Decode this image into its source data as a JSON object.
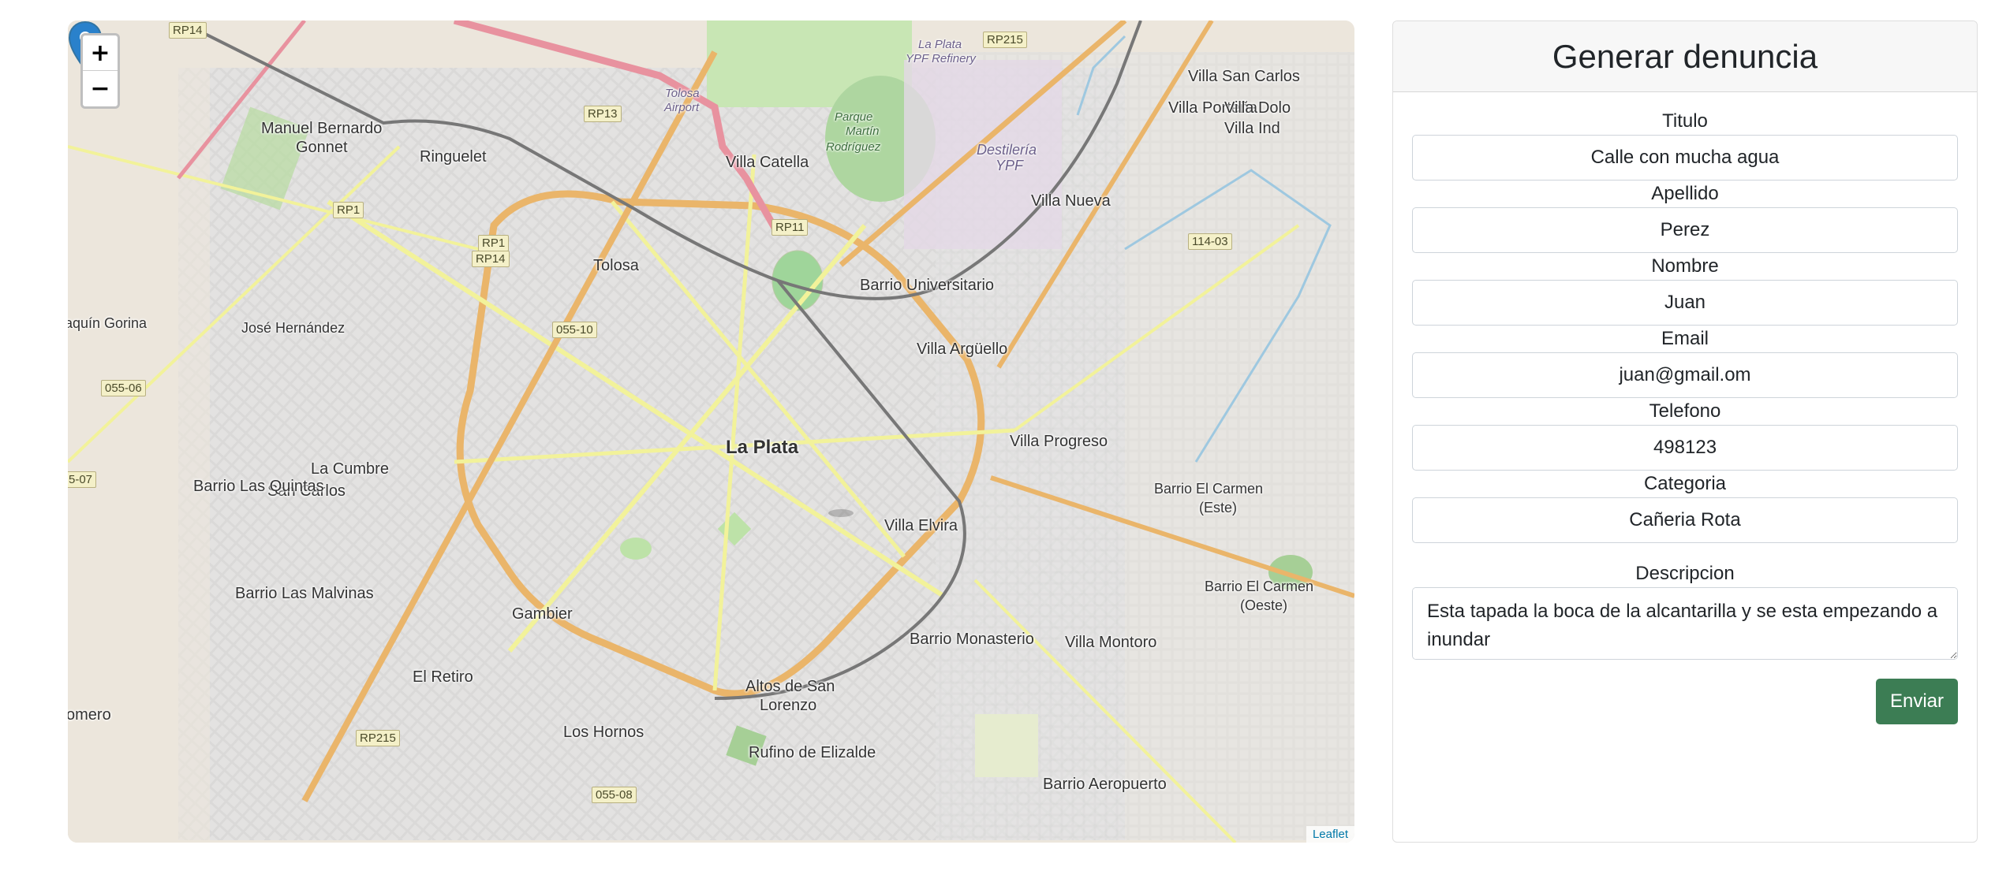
{
  "map": {
    "zoom_in": "+",
    "zoom_out": "−",
    "attribution": "Leaflet",
    "places": [
      {
        "name": "Manuel Bernardo",
        "size": "l"
      },
      {
        "name": "Gonnet",
        "size": "l"
      },
      {
        "name": "Ringuelet",
        "size": "l"
      },
      {
        "name": "Tolosa",
        "size": "l"
      },
      {
        "name": "José Hernández",
        "size": "m"
      },
      {
        "name": "aquín Gorina",
        "size": "m"
      },
      {
        "name": "La Plata",
        "size": "xl"
      },
      {
        "name": "La Cumbre",
        "size": "l"
      },
      {
        "name": "San Carlos",
        "size": "l"
      },
      {
        "name": "Barrio Las Quintas",
        "size": "l"
      },
      {
        "name": "Barrio Las Malvinas",
        "size": "l"
      },
      {
        "name": "Gambier",
        "size": "l"
      },
      {
        "name": "El Retiro",
        "size": "l"
      },
      {
        "name": "omero",
        "size": "l"
      },
      {
        "name": "Los Hornos",
        "size": "l"
      },
      {
        "name": "Altos de San",
        "size": "l"
      },
      {
        "name": "Lorenzo",
        "size": "l"
      },
      {
        "name": "Rufino de Elizalde",
        "size": "l"
      },
      {
        "name": "Villa Elvira",
        "size": "l"
      },
      {
        "name": "Barrio Monasterio",
        "size": "l"
      },
      {
        "name": "Villa Montoro",
        "size": "l"
      },
      {
        "name": "Barrio Aeropuerto",
        "size": "l"
      },
      {
        "name": "Villa Progreso",
        "size": "l"
      },
      {
        "name": "Barrio El Carmen",
        "size": "m"
      },
      {
        "name": "(Este)",
        "size": "m"
      },
      {
        "name": "Barrio El Carmen",
        "size": "m"
      },
      {
        "name": "(Oeste)",
        "size": "m"
      },
      {
        "name": "Villa Argüello",
        "size": "l"
      },
      {
        "name": "Barrio Universitario",
        "size": "l"
      },
      {
        "name": "Villa Nueva",
        "size": "l"
      },
      {
        "name": "Villa Catella",
        "size": "l"
      },
      {
        "name": "Villa San Carlos",
        "size": "l"
      },
      {
        "name": "Villa Porteña",
        "size": "l"
      },
      {
        "name": "Villa Dolo",
        "size": "l"
      },
      {
        "name": "Villa Ind",
        "size": "l"
      },
      {
        "name": "Destilería",
        "size": "i"
      },
      {
        "name": "YPF",
        "size": "i"
      },
      {
        "name": "La Plata",
        "size": "s"
      },
      {
        "name": "YPF Refinery",
        "size": "s"
      },
      {
        "name": "Parque",
        "size": "g"
      },
      {
        "name": "Martín",
        "size": "g"
      },
      {
        "name": "Rodríguez",
        "size": "g"
      },
      {
        "name": "Tolosa",
        "size": "s"
      },
      {
        "name": "Airport",
        "size": "s"
      }
    ],
    "shields": [
      "RP14",
      "RP13",
      "RP1",
      "RP1",
      "RP14",
      "RP11",
      "RP215",
      "055-10",
      "055-06",
      "5-07",
      "114-03",
      "RP215",
      "055-08"
    ]
  },
  "form": {
    "title": "Generar denuncia",
    "fields": [
      {
        "label": "Titulo",
        "value": "Calle con mucha agua"
      },
      {
        "label": "Apellido",
        "value": "Perez"
      },
      {
        "label": "Nombre",
        "value": "Juan"
      },
      {
        "label": "Email",
        "value": "juan@gmail.om"
      },
      {
        "label": "Telefono",
        "value": "498123"
      },
      {
        "label": "Categoria",
        "value": "Cañeria Rota"
      }
    ],
    "description_label": "Descripcion",
    "description_value": "Esta tapada la boca de la alcantarilla y se esta empezando a inundar",
    "submit_label": "Enviar"
  },
  "colors": {
    "submit_button": "#3c7d54",
    "marker": "#2a81cb",
    "map_background": "#ece6dc"
  }
}
